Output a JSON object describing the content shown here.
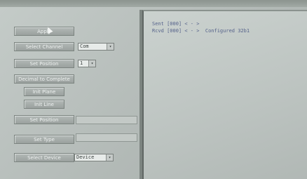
{
  "panel": {
    "buttons": [
      {
        "label": "Apply"
      },
      {
        "label": "Select Channel"
      },
      {
        "label": "Set Position"
      },
      {
        "label": "Decimal to Complete"
      },
      {
        "label": "Init Plane"
      },
      {
        "label": "Init Line"
      },
      {
        "label": "Set Position"
      },
      {
        "label": "Set Type"
      },
      {
        "label": "Select Device"
      }
    ],
    "channel_select": {
      "value": "Com",
      "arrow": "▾"
    },
    "position_select": {
      "value": "1",
      "arrow": "▾"
    },
    "device_select": {
      "value": "Device",
      "arrow": "▾"
    }
  },
  "console": {
    "lines": [
      "Sent [000] < - >",
      "Rcvd [000] < - >  Configured 32b1"
    ]
  },
  "colors": {
    "console_text": "#55628a",
    "button_face": "#a9b0ad",
    "background": "#b4bbb8"
  },
  "icons": {
    "cursor": "mouse-pointer-icon",
    "dropdown": "chevron-down-icon"
  }
}
